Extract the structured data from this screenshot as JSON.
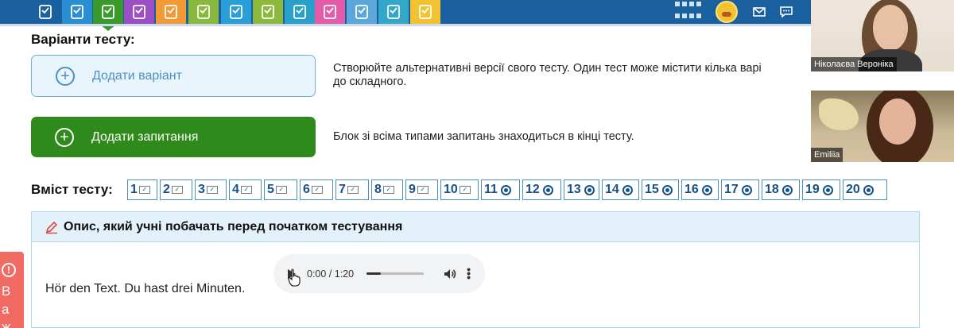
{
  "toolbar": {
    "tools": [
      {
        "icon": "snowflake-logo-icon",
        "color": "#1a5f9e"
      },
      {
        "icon": "search-document-icon",
        "color": "#2a8fd2"
      },
      {
        "icon": "test-checkbox-icon",
        "color": "#3a9a2c"
      },
      {
        "icon": "puzzle-tools-icon",
        "color": "#9b4fc4"
      },
      {
        "icon": "image-search-icon",
        "color": "#f29a33"
      },
      {
        "icon": "pencil-icon",
        "color": "#88b93c"
      },
      {
        "icon": "cursor-icon",
        "color": "#2a9ed6"
      },
      {
        "icon": "qr-code-icon",
        "color": "#8cb83b"
      },
      {
        "icon": "tablet-icon",
        "color": "#2aa0c8"
      },
      {
        "icon": "magic-wand-icon",
        "color": "#e45ba9"
      },
      {
        "icon": "mouse-icon",
        "color": "#5ca7d9"
      },
      {
        "icon": "briefcase-icon",
        "color": "#33a7c9"
      },
      {
        "icon": "graduation-cap-icon",
        "color": "#f2c230"
      }
    ],
    "active_index": 2
  },
  "variants": {
    "title": "Варіанти тесту:",
    "add_variant_label": "Додати варіант",
    "add_variant_description": "Створюйте альтернативні версії свого тесту. Один тест може містити кілька варі",
    "add_variant_description_2": "до складного.",
    "add_question_label": "Додати запитання",
    "add_question_description": "Блок зі всіма типами запитань знаходиться в кінці тесту."
  },
  "contents": {
    "title": "Вміст тесту:",
    "questions": [
      {
        "num": "1",
        "type": "checkbox"
      },
      {
        "num": "2",
        "type": "checkbox"
      },
      {
        "num": "3",
        "type": "checkbox"
      },
      {
        "num": "4",
        "type": "checkbox"
      },
      {
        "num": "5",
        "type": "checkbox"
      },
      {
        "num": "6",
        "type": "checkbox"
      },
      {
        "num": "7",
        "type": "checkbox"
      },
      {
        "num": "8",
        "type": "checkbox"
      },
      {
        "num": "9",
        "type": "checkbox"
      },
      {
        "num": "10",
        "type": "checkbox"
      },
      {
        "num": "11",
        "type": "radio"
      },
      {
        "num": "12",
        "type": "radio"
      },
      {
        "num": "13",
        "type": "radio"
      },
      {
        "num": "14",
        "type": "radio"
      },
      {
        "num": "15",
        "type": "radio"
      },
      {
        "num": "16",
        "type": "radio"
      },
      {
        "num": "17",
        "type": "radio"
      },
      {
        "num": "18",
        "type": "radio"
      },
      {
        "num": "19",
        "type": "radio"
      },
      {
        "num": "20",
        "type": "radio"
      }
    ]
  },
  "description_panel": {
    "title": "Опис, який учні побачать перед початком тестування",
    "text": "Hör den Text. Du hast drei Minuten.",
    "audio": {
      "time": "0:00 / 1:20",
      "progress": 0.25
    }
  },
  "side_alert": {
    "letters": [
      "B",
      "a",
      "ж"
    ]
  },
  "video_tiles": [
    {
      "name": "Ніколаєва Вероніка"
    },
    {
      "name": "Emiliia"
    }
  ]
}
